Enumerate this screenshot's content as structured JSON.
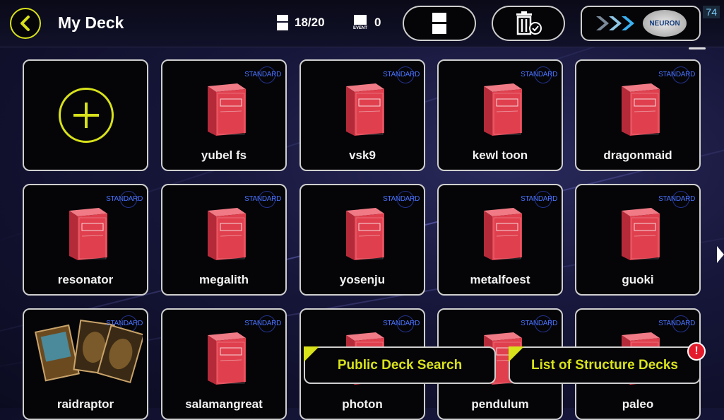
{
  "header": {
    "title": "My Deck",
    "deck_count": "18/20",
    "event_count": "0",
    "fps": "74",
    "neuron_label": "NEURON"
  },
  "decks": [
    {
      "name": "",
      "badge": "",
      "kind": "add"
    },
    {
      "name": "yubel fs",
      "badge": "STANDARD",
      "kind": "box"
    },
    {
      "name": "vsk9",
      "badge": "STANDARD",
      "kind": "box"
    },
    {
      "name": "kewl toon",
      "badge": "STANDARD",
      "kind": "box"
    },
    {
      "name": "dragonmaid",
      "badge": "STANDARD",
      "kind": "box"
    },
    {
      "name": "resonator",
      "badge": "STANDARD",
      "kind": "box"
    },
    {
      "name": "megalith",
      "badge": "STANDARD",
      "kind": "box"
    },
    {
      "name": "yosenju",
      "badge": "STANDARD",
      "kind": "box"
    },
    {
      "name": "metalfoest",
      "badge": "STANDARD",
      "kind": "box"
    },
    {
      "name": "guoki",
      "badge": "STANDARD",
      "kind": "box"
    },
    {
      "name": "raidraptor",
      "badge": "STANDARD",
      "kind": "cards"
    },
    {
      "name": "salamangreat",
      "badge": "STANDARD",
      "kind": "box"
    },
    {
      "name": "photon",
      "badge": "STANDARD",
      "kind": "box"
    },
    {
      "name": "pendulum",
      "badge": "STANDARD",
      "kind": "box"
    },
    {
      "name": "paleo",
      "badge": "STANDARD",
      "kind": "box"
    }
  ],
  "buttons": {
    "public_search": "Public Deck Search",
    "structure_decks": "List of Structure Decks",
    "alert": "!"
  },
  "colors": {
    "accent": "#d8e21a",
    "deckbox": "#e0404e",
    "badge": "#4a73ff",
    "alert": "#e31b2b"
  }
}
